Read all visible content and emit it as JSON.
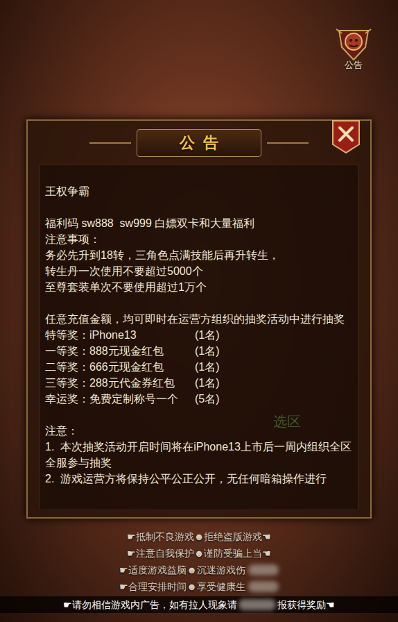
{
  "corner_button": {
    "label": "公告"
  },
  "dialog": {
    "title": "公告",
    "background_text": "选区",
    "body": [
      {
        "kind": "text",
        "text": "王权争霸"
      },
      {
        "kind": "blank"
      },
      {
        "kind": "text",
        "text": "福利码 sw888  sw999 白嫖双卡和大量福利"
      },
      {
        "kind": "text",
        "text": "注意事项："
      },
      {
        "kind": "text",
        "text": "务必先升到18转，三角色点满技能后再升转生，"
      },
      {
        "kind": "text",
        "text": "转生丹一次使用不要超过5000个"
      },
      {
        "kind": "text",
        "text": "至尊套装单次不要使用超过1万个"
      },
      {
        "kind": "blank"
      },
      {
        "kind": "text",
        "text": "任意充值金额，均可即时在运营方组织的抽奖活动中进行抽奖"
      },
      {
        "kind": "prize",
        "label": "特等奖：iPhone13",
        "count": "(1名)"
      },
      {
        "kind": "prize",
        "label": "一等奖：888元现金红包",
        "count": "(1名)"
      },
      {
        "kind": "prize",
        "label": "二等奖：666元现金红包",
        "count": "(1名)"
      },
      {
        "kind": "prize",
        "label": "三等奖：288元代金券红包",
        "count": "(1名)"
      },
      {
        "kind": "prize",
        "label": "幸运奖：免费定制称号一个",
        "count": "(5名)"
      },
      {
        "kind": "blank"
      },
      {
        "kind": "text",
        "text": "注意："
      },
      {
        "kind": "text",
        "text": "1.  本次抽奖活动开启时间将在iPhone13上市后一周内组织全区全服参与抽奖"
      },
      {
        "kind": "text",
        "text": "2.  游戏运营方将保持公平公正公开，无任何暗箱操作进行"
      }
    ]
  },
  "notices": [
    {
      "text": "☛抵制不良游戏☻拒绝盗版游戏☚",
      "obscured": false
    },
    {
      "text": "☛注意自我保护☻谨防受骗上当☚",
      "obscured": false
    },
    {
      "text": "☛适度游戏益脑☻沉迷游戏伤",
      "obscured": true
    },
    {
      "text": "☛合理安排时间☻享受健康生",
      "obscured": true
    }
  ],
  "bottom_bar": {
    "parts": [
      "☛请勿相信游戏内广告，如有拉人现象请",
      "报获得奖励☚"
    ]
  }
}
